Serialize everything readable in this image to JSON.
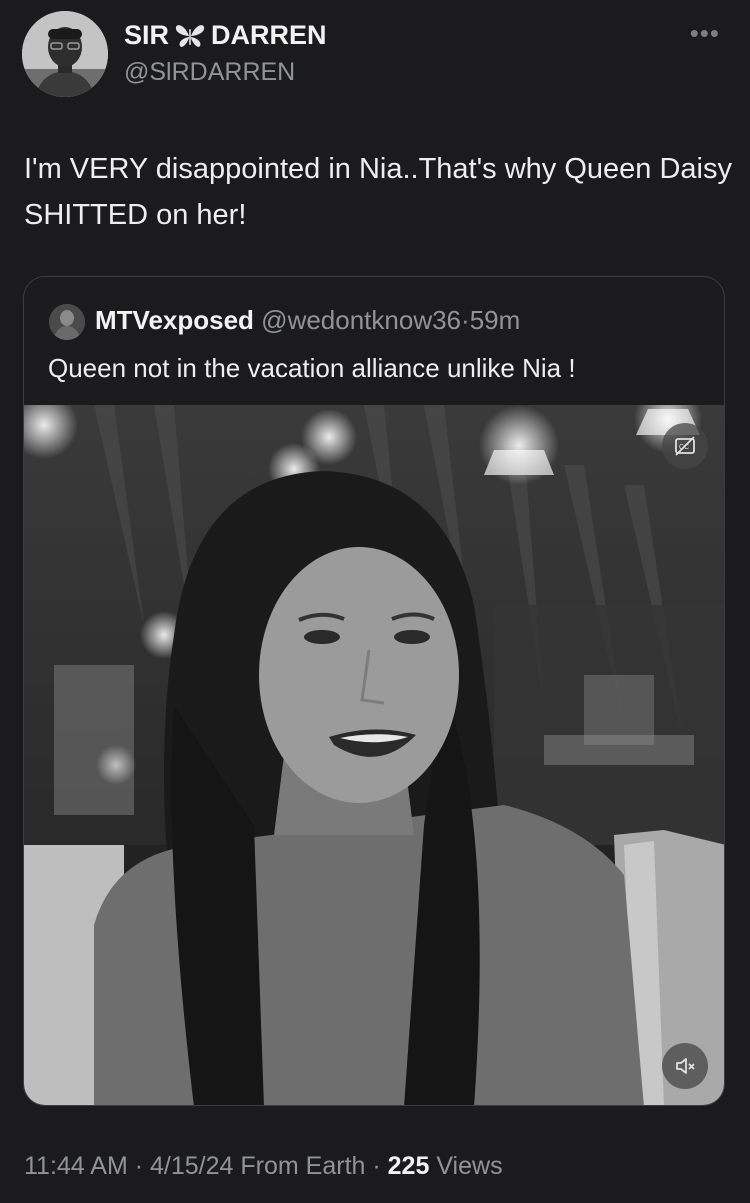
{
  "author": {
    "name_first": "SIR",
    "name_last": "DARREN",
    "handle": "@SlRDARREN",
    "more_label": "•••"
  },
  "tweet": {
    "text": "I'm VERY disappointed in Nia..That's why Queen Daisy SHITTED on her!"
  },
  "quoted": {
    "name": "MTVexposed",
    "handle": "@wedontknow36",
    "separator": "·",
    "time": "59m",
    "text": "Queen not in the vacation alliance unlike Nia !"
  },
  "media": {
    "type": "video",
    "captions_icon": "captions-off-icon",
    "mute_icon": "speaker-muted-icon"
  },
  "footer": {
    "time": "11:44 AM",
    "date": "4/15/24",
    "source": "From Earth",
    "views_count": "225",
    "views_label": "Views"
  },
  "colors": {
    "background": "#1b1b1d",
    "text": "#e7e9ea",
    "secondary": "#8f9499",
    "border": "#3a3d41"
  }
}
